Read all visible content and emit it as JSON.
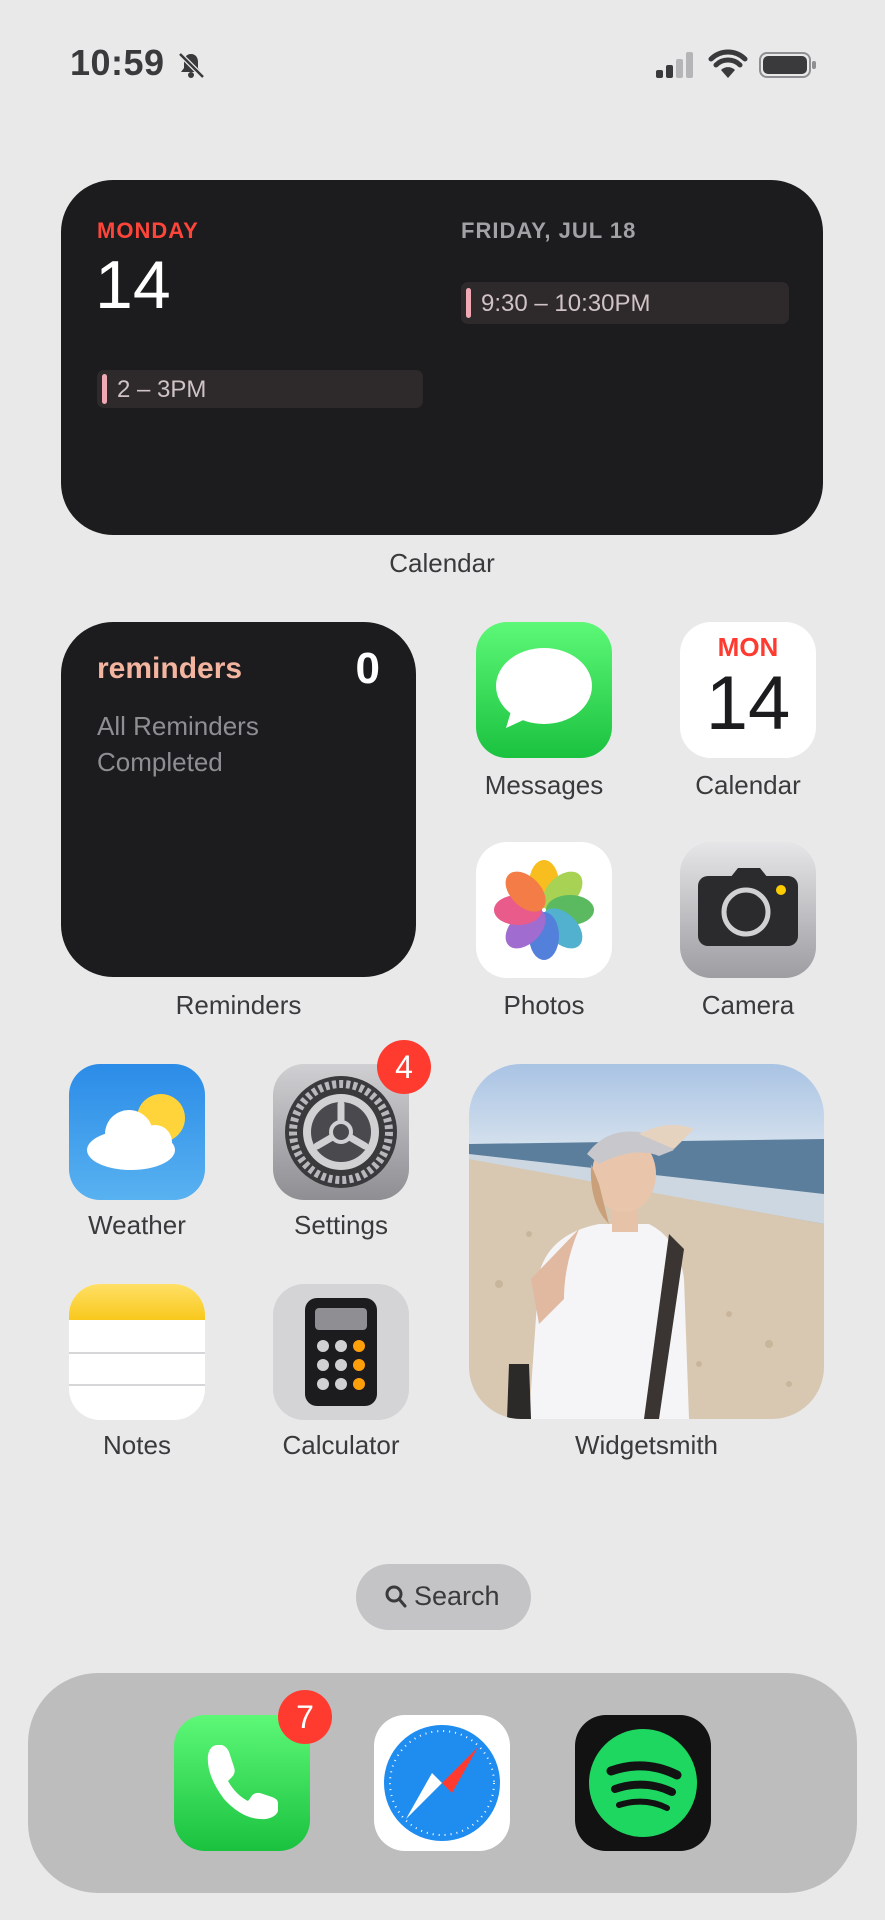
{
  "status_bar": {
    "time": "10:59",
    "icons": [
      "bell-slash-icon",
      "cellular-signal-icon",
      "wifi-icon",
      "battery-icon"
    ]
  },
  "calendar_widget": {
    "today_day": "MONDAY",
    "today_date": "14",
    "today_event_time": "2 – 3PM",
    "upcoming_day": "FRIDAY, JUL 18",
    "upcoming_event_time": "9:30 – 10:30PM",
    "label": "Calendar"
  },
  "reminders_widget": {
    "title": "reminders",
    "count": "0",
    "message": "All Reminders Completed",
    "label": "Reminders"
  },
  "apps": {
    "messages": "Messages",
    "calendar": {
      "label": "Calendar",
      "month": "MON",
      "date": "14"
    },
    "photos": "Photos",
    "camera": "Camera",
    "weather": "Weather",
    "settings": {
      "label": "Settings",
      "badge": "4"
    },
    "notes": "Notes",
    "calculator": "Calculator"
  },
  "photo_widget": {
    "label": "Widgetsmith"
  },
  "search": {
    "label": "Search"
  },
  "dock": {
    "phone_badge": "7",
    "apps": [
      "phone-icon",
      "safari-icon",
      "spotify-icon"
    ]
  },
  "colors": {
    "background": "#e9e9ea",
    "widget": "#1c1c1e",
    "badge": "#ff3b30",
    "calendar_red": "#ff453a"
  }
}
